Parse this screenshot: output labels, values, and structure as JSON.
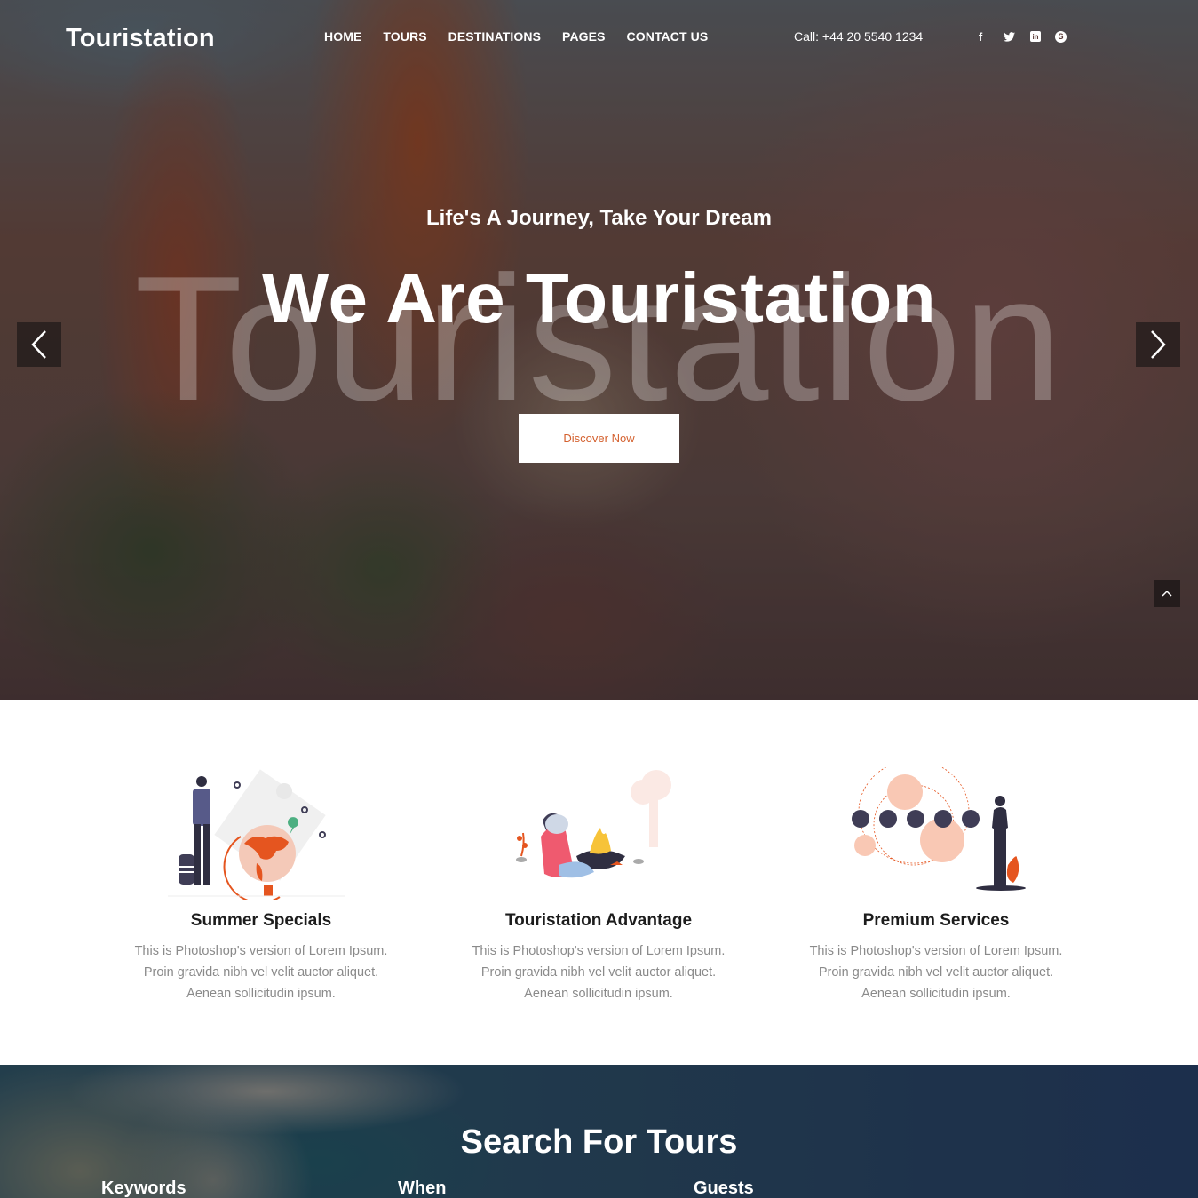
{
  "header": {
    "logo": "Touristation",
    "nav": [
      "HOME",
      "TOURS",
      "DESTINATIONS",
      "PAGES",
      "CONTACT US"
    ],
    "call": "Call: +44 20 5540 1234",
    "social": [
      {
        "name": "facebook-icon",
        "glyph": "f"
      },
      {
        "name": "twitter-icon",
        "glyph": "🐦"
      },
      {
        "name": "linkedin-icon",
        "glyph": "in"
      },
      {
        "name": "skype-icon",
        "glyph": "S"
      }
    ]
  },
  "hero": {
    "tagline": "Life's A Journey, Take Your Dream",
    "headline": "We Are Touristation",
    "watermark": "Touristation",
    "cta": "Discover Now",
    "accent_color": "#d4602e"
  },
  "features": [
    {
      "title": "Summer Specials",
      "lines": [
        "This is Photoshop's version of Lorem Ipsum.",
        "Proin gravida nibh vel velit auctor aliquet.",
        "Aenean sollicitudin ipsum."
      ],
      "illustration": "traveler-globe"
    },
    {
      "title": "Touristation Advantage",
      "lines": [
        "This is Photoshop's version of Lorem Ipsum.",
        "Proin gravida nibh vel velit auctor aliquet.",
        "Aenean sollicitudin ipsum."
      ],
      "illustration": "campfire"
    },
    {
      "title": "Premium Services",
      "lines": [
        "This is Photoshop's version of Lorem Ipsum.",
        "Proin gravida nibh vel velit auctor aliquet.",
        "Aenean sollicitudin ipsum."
      ],
      "illustration": "services-orbit"
    }
  ],
  "search": {
    "title": "Search For Tours",
    "labels": [
      "Keywords",
      "When",
      "Guests"
    ]
  }
}
